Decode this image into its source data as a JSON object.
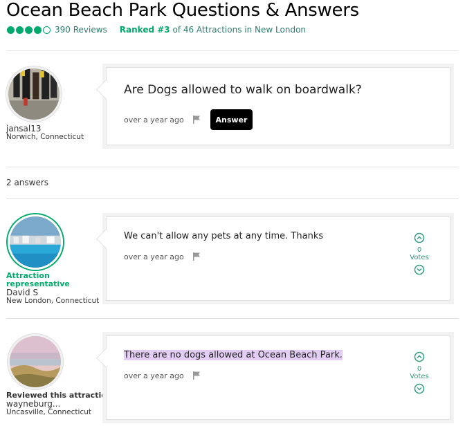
{
  "header": {
    "title": "Ocean Beach Park Questions & Answers",
    "rating_bubbles": 4,
    "reviews": "390 Reviews",
    "rank_prefix": "Ranked ",
    "rank": "#3",
    "rank_suffix": " of 46 Attractions in New London",
    "accent": "#00aa6c"
  },
  "question": {
    "user": {
      "name": "jansal13",
      "location": "Norwich, Connecticut"
    },
    "text": "Are Dogs allowed to walk on boardwalk?",
    "time": "over a year ago",
    "answer_label": "Answer"
  },
  "answers_count": "2 answers",
  "answers": [
    {
      "badge": "Attraction representative",
      "name": "David S",
      "location": "New London, Connecticut",
      "text": "We can't allow any pets at any time. Thanks",
      "time": "over a year ago",
      "votes": "0",
      "votes_label": "Votes"
    },
    {
      "reviewed": "Reviewed this attraction",
      "name": "wayneburg...",
      "location": "Uncasville, Connecticut",
      "text": "There are no dogs allowed at Ocean Beach Park.",
      "time": "over a year ago",
      "votes": "0",
      "votes_label": "Votes"
    }
  ]
}
